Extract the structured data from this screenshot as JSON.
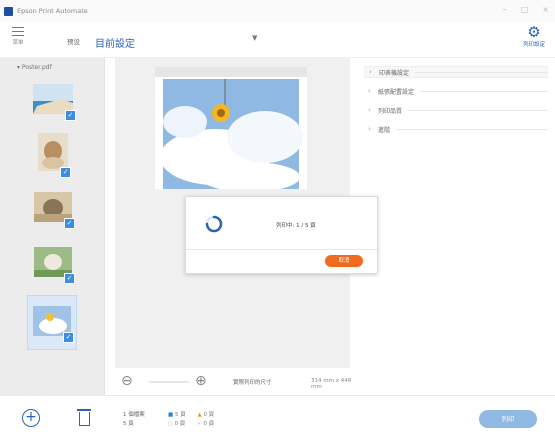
{
  "window": {
    "title": "Epson Print Automate",
    "controls": [
      "–",
      "□",
      "×"
    ]
  },
  "toolbar": {
    "menu_label": "菜单",
    "preset_label": "预设",
    "preset_value": "目前設定",
    "settings_label": "列印設定",
    "menu_icon": "hamburger-icon",
    "settings_icon": "gear-icon"
  },
  "files": {
    "header": "Poster.pdf",
    "thumbnails": [
      {
        "name": "sea-photo",
        "checked": true,
        "selected": false
      },
      {
        "name": "dog-photo",
        "checked": true,
        "selected": false
      },
      {
        "name": "cat-photo",
        "checked": true,
        "selected": false
      },
      {
        "name": "puppy-photo",
        "checked": true,
        "selected": false
      },
      {
        "name": "flower-photo",
        "checked": true,
        "selected": true
      }
    ]
  },
  "preview": {
    "zoom_out_icon": "zoom-out-icon",
    "zoom_in_icon": "zoom-in-icon",
    "size_label": "實際列印的尺寸",
    "size_value": "314 mm x 446 mm"
  },
  "right_menu": {
    "items": [
      {
        "label": "印表機設定"
      },
      {
        "label": "紙張配置設定"
      },
      {
        "label": "列印品質"
      },
      {
        "label": "進階"
      }
    ]
  },
  "dialog": {
    "status": "列印中: 1 / 5 頁",
    "cancel_label": "取消"
  },
  "bottom": {
    "files_count": "1 個檔案",
    "pages_count": "5 頁",
    "stat_a": "5 頁",
    "stat_b": "0 頁",
    "stat_c": "0 頁",
    "stat_d": "0 頁",
    "print_label": "列印"
  },
  "colors": {
    "accent": "#2a63b8",
    "cancel": "#f06a1f",
    "print_button": "#8fb8e3"
  }
}
